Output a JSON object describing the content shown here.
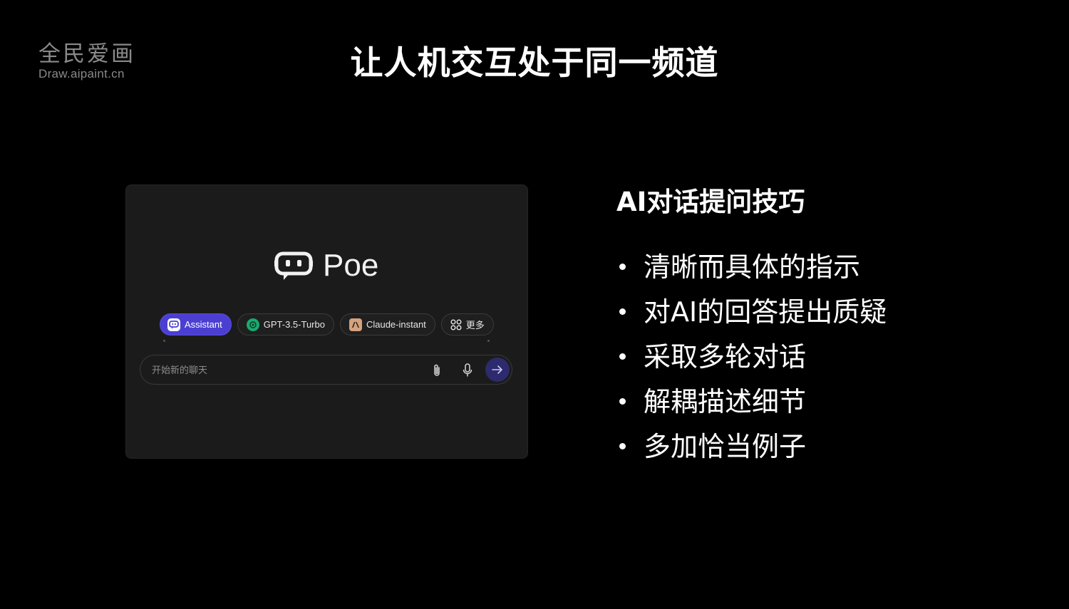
{
  "watermark": {
    "cn": "全民爱画",
    "en": "Draw.aipaint.cn"
  },
  "slide": {
    "title": "让人机交互处于同一频道"
  },
  "poe": {
    "brand": "Poe",
    "logo_icon": "poe-robot-icon",
    "bots": [
      {
        "label": "Assistant",
        "icon": "assistant-icon",
        "active": true
      },
      {
        "label": "GPT-3.5-Turbo",
        "icon": "openai-icon",
        "active": false
      },
      {
        "label": "Claude-instant",
        "icon": "anthropic-icon",
        "active": false
      },
      {
        "label": "更多",
        "icon": "grid-more-icon",
        "active": false
      }
    ],
    "input": {
      "placeholder": "开始新的聊天",
      "value": ""
    },
    "colors": {
      "panel_bg": "#1b1b1b",
      "accent": "#4b3fd1",
      "send_bg": "#2e2a6e"
    }
  },
  "tips": {
    "heading": "AI对话提问技巧",
    "items": [
      "清晰而具体的指示",
      "对AI的回答提出质疑",
      "采取多轮对话",
      "解耦描述细节",
      "多加恰当例子"
    ]
  }
}
